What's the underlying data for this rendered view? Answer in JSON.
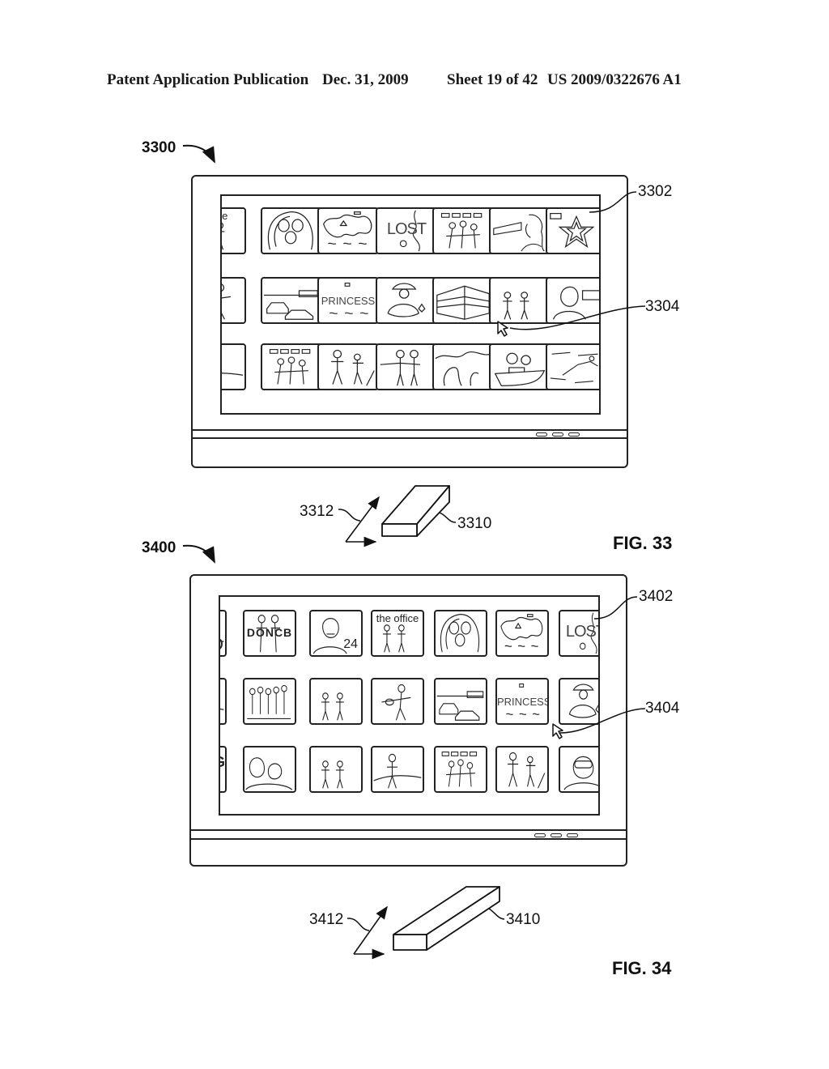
{
  "header": {
    "publication": "Patent Application Publication",
    "date": "Dec. 31, 2009",
    "sheet": "Sheet 19 of 42",
    "number": "US 2009/0322676 A1"
  },
  "figures": [
    {
      "id": "fig33",
      "label": "FIG. 33",
      "device_ref": "3300",
      "grid_ref": "3302",
      "cursor_ref": "3304",
      "remote_ref": "3310",
      "motion_ref": "3312",
      "tiles": [
        [
          {
            "art": "people",
            "caption": "office"
          },
          {
            "art": "drops",
            "caption": ""
          },
          {
            "art": "blob",
            "caption": ""
          },
          {
            "art": "lost",
            "caption": "LOST"
          },
          {
            "art": "group",
            "caption": ""
          },
          {
            "art": "woman-profile",
            "caption": ""
          },
          {
            "art": "star",
            "caption": ""
          }
        ],
        [
          {
            "art": "guitar",
            "caption": ""
          },
          {
            "art": "cars",
            "caption": ""
          },
          {
            "art": "princess",
            "caption": "PRINCESS"
          },
          {
            "art": "child",
            "caption": ""
          },
          {
            "art": "building",
            "caption": ""
          },
          {
            "art": "people",
            "caption": ""
          },
          {
            "art": "portrait",
            "caption": ""
          }
        ],
        [
          {
            "art": "figure",
            "caption": ""
          },
          {
            "art": "group",
            "caption": ""
          },
          {
            "art": "runners",
            "caption": ""
          },
          {
            "art": "two-women",
            "caption": ""
          },
          {
            "art": "landscape",
            "caption": ""
          },
          {
            "art": "couple-boat",
            "caption": ""
          },
          {
            "art": "swimmer",
            "caption": ""
          }
        ]
      ]
    },
    {
      "id": "fig34",
      "label": "FIG. 34",
      "device_ref": "3400",
      "grid_ref": "3402",
      "cursor_ref": "3404",
      "remote_ref": "3410",
      "motion_ref": "3412",
      "tiles": [
        [
          {
            "art": "figure",
            "caption": "D"
          },
          {
            "art": "couple",
            "caption": "DONCB"
          },
          {
            "art": "man-portrait",
            "caption": "24"
          },
          {
            "art": "people",
            "caption": "the office"
          },
          {
            "art": "drops",
            "caption": ""
          },
          {
            "art": "blob",
            "caption": ""
          },
          {
            "art": "lost",
            "caption": "LOST"
          }
        ],
        [
          {
            "art": "figure",
            "caption": ""
          },
          {
            "art": "crowd",
            "caption": ""
          },
          {
            "art": "people",
            "caption": ""
          },
          {
            "art": "guitar",
            "caption": ""
          },
          {
            "art": "cars",
            "caption": ""
          },
          {
            "art": "princess",
            "caption": "PRINCESS"
          },
          {
            "art": "child",
            "caption": ""
          }
        ],
        [
          {
            "art": "text",
            "caption": "FEI NG"
          },
          {
            "art": "faces",
            "caption": ""
          },
          {
            "art": "people",
            "caption": ""
          },
          {
            "art": "figure",
            "caption": ""
          },
          {
            "art": "group",
            "caption": ""
          },
          {
            "art": "runners",
            "caption": ""
          },
          {
            "art": "goggles",
            "caption": ""
          }
        ]
      ]
    }
  ]
}
